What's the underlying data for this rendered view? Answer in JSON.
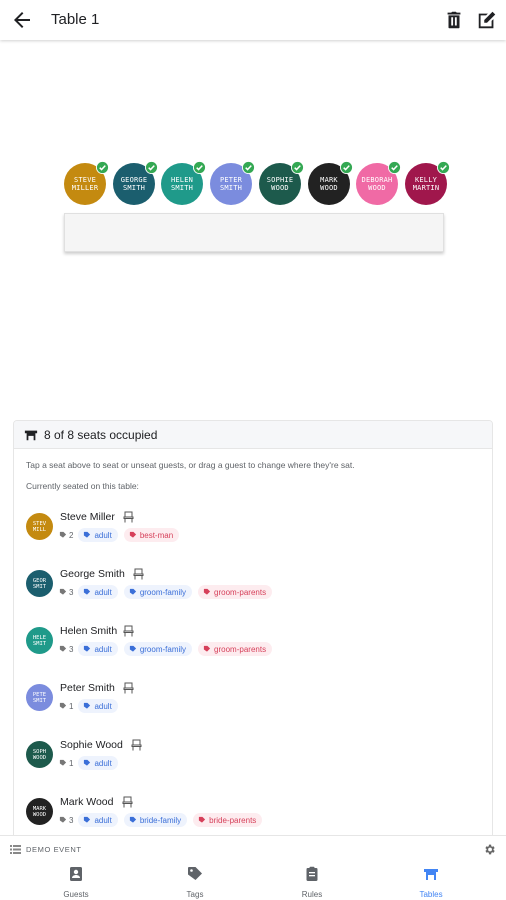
{
  "header": {
    "title": "Table 1"
  },
  "seats": [
    {
      "initials": "STEVE MILLER",
      "color": "#c48a10"
    },
    {
      "initials": "GEORGE SMITH",
      "color": "#1b5e6e"
    },
    {
      "initials": "HELEN SMITH",
      "color": "#1f9a8a"
    },
    {
      "initials": "PETER SMITH",
      "color": "#7b8cde"
    },
    {
      "initials": "SOPHIE WOOD",
      "color": "#1d5a4c"
    },
    {
      "initials": "MARK WOOD",
      "color": "#222222"
    },
    {
      "initials": "DEBORAH WOOD",
      "color": "#f06aa5"
    },
    {
      "initials": "KELLY MARTIN",
      "color": "#a0174c"
    }
  ],
  "panel": {
    "occupancy": "8 of 8 seats occupied",
    "hint": "Tap a seat above to seat or unseat guests, or drag a guest to change where they're sat.",
    "subheading": "Currently seated on this table:"
  },
  "guests": [
    {
      "name": "Steve Miller",
      "avatar": "STEV MILL",
      "color": "#c48a10",
      "count": "2",
      "tags": [
        {
          "label": "adult",
          "kind": "blue"
        },
        {
          "label": "best-man",
          "kind": "red"
        }
      ]
    },
    {
      "name": "George Smith",
      "avatar": "GEOR SMIT",
      "color": "#1b5e6e",
      "count": "3",
      "tags": [
        {
          "label": "adult",
          "kind": "blue"
        },
        {
          "label": "groom-family",
          "kind": "blue"
        },
        {
          "label": "groom-parents",
          "kind": "red"
        }
      ]
    },
    {
      "name": "Helen Smith",
      "avatar": "HELE SMIT",
      "color": "#1f9a8a",
      "count": "3",
      "tags": [
        {
          "label": "adult",
          "kind": "blue"
        },
        {
          "label": "groom-family",
          "kind": "blue"
        },
        {
          "label": "groom-parents",
          "kind": "red"
        }
      ]
    },
    {
      "name": "Peter Smith",
      "avatar": "PETE SMIT",
      "color": "#7b8cde",
      "count": "1",
      "tags": [
        {
          "label": "adult",
          "kind": "blue"
        }
      ]
    },
    {
      "name": "Sophie Wood",
      "avatar": "SOPH WOOD",
      "color": "#1d5a4c",
      "count": "1",
      "tags": [
        {
          "label": "adult",
          "kind": "blue"
        }
      ]
    },
    {
      "name": "Mark Wood",
      "avatar": "MARK WOOD",
      "color": "#222222",
      "count": "3",
      "tags": [
        {
          "label": "adult",
          "kind": "blue"
        },
        {
          "label": "bride-family",
          "kind": "blue"
        },
        {
          "label": "bride-parents",
          "kind": "red"
        }
      ]
    }
  ],
  "bottom": {
    "event": "DEMO EVENT",
    "nav": [
      {
        "label": "Guests"
      },
      {
        "label": "Tags"
      },
      {
        "label": "Rules"
      },
      {
        "label": "Tables"
      }
    ]
  },
  "colors": {
    "accent": "#4285f4",
    "check": "#34a853",
    "tag_blue_bg": "#eef3fd",
    "tag_blue_fg": "#3b6fd8",
    "tag_red_bg": "#fdecef",
    "tag_red_fg": "#d6405a"
  }
}
